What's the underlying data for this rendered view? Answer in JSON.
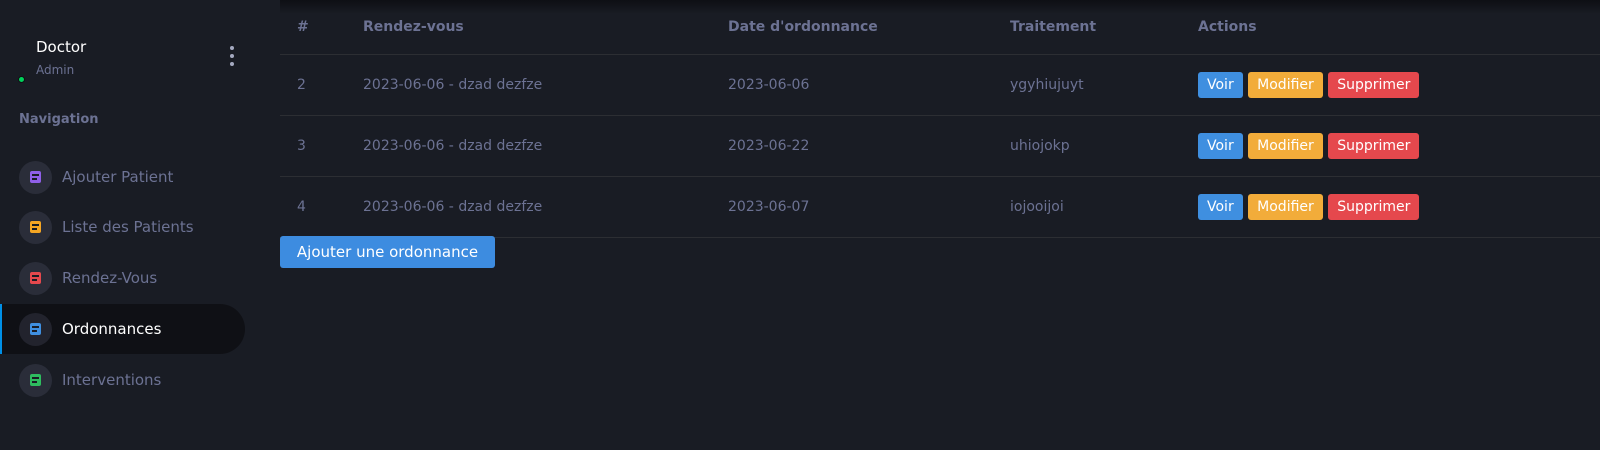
{
  "profile": {
    "name": "Doctor",
    "role": "Admin",
    "status_color": "#00d25b"
  },
  "sidebar": {
    "section_title": "Navigation",
    "items": [
      {
        "label": "Ajouter Patient",
        "icon": "document-icon",
        "color": "#8f5fe8",
        "active": false
      },
      {
        "label": "Liste des Patients",
        "icon": "document-icon",
        "color": "#f5a623",
        "active": false
      },
      {
        "label": "Rendez-Vous",
        "icon": "document-icon",
        "color": "#e5484d",
        "active": false
      },
      {
        "label": "Ordonnances",
        "icon": "document-icon",
        "color": "#3f8fe0",
        "active": true
      },
      {
        "label": "Interventions",
        "icon": "document-icon",
        "color": "#2ebd5f",
        "active": false
      }
    ]
  },
  "table": {
    "headers": [
      "#",
      "Rendez-vous",
      "Date d'ordonnance",
      "Traitement",
      "Actions"
    ],
    "rows": [
      {
        "id": "2",
        "rdv": "2023-06-06 - dzad dezfze",
        "date": "2023-06-06",
        "traitement": "ygyhiujuyt"
      },
      {
        "id": "3",
        "rdv": "2023-06-06 - dzad dezfze",
        "date": "2023-06-22",
        "traitement": "uhiojokp"
      },
      {
        "id": "4",
        "rdv": "2023-06-06 - dzad dezfze",
        "date": "2023-06-07",
        "traitement": "iojooijoi"
      }
    ],
    "actions": {
      "view": "Voir",
      "edit": "Modifier",
      "delete": "Supprimer"
    }
  },
  "add_button_label": "Ajouter une ordonnance",
  "colors": {
    "background": "#191c24",
    "primary": "#3f8fe0",
    "warning": "#f2ac3a",
    "danger": "#e5484d"
  }
}
